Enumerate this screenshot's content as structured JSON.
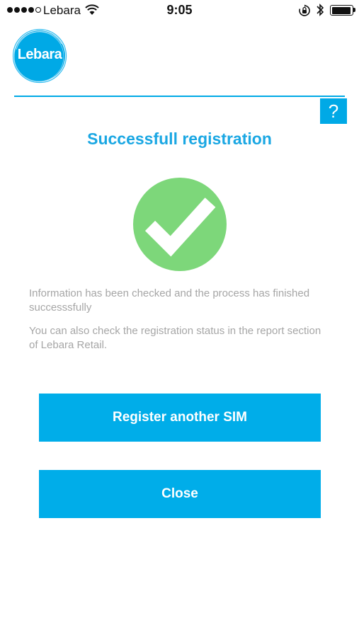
{
  "status_bar": {
    "carrier": "Lebara",
    "time": "9:05",
    "signal_bars": 4,
    "signal_max": 5,
    "battery_level": 0.95
  },
  "header": {
    "logo_text": "Lebara",
    "help_label": "?"
  },
  "main": {
    "title": "Successfull registration",
    "message_1": "Information has been checked and the process has finished successsfully",
    "message_2": "You can also check the registration status in the report section of Lebara Retail.",
    "register_button_label": "Register another SIM",
    "close_button_label": "Close"
  },
  "colors": {
    "accent": "#00ade9",
    "title": "#1aa7e3",
    "success": "#7dd77a",
    "message_text": "#a6a6a6"
  },
  "icons": {
    "logo": "lebara-logo-icon",
    "success": "checkmark-circle-icon",
    "help": "question-mark-icon"
  }
}
